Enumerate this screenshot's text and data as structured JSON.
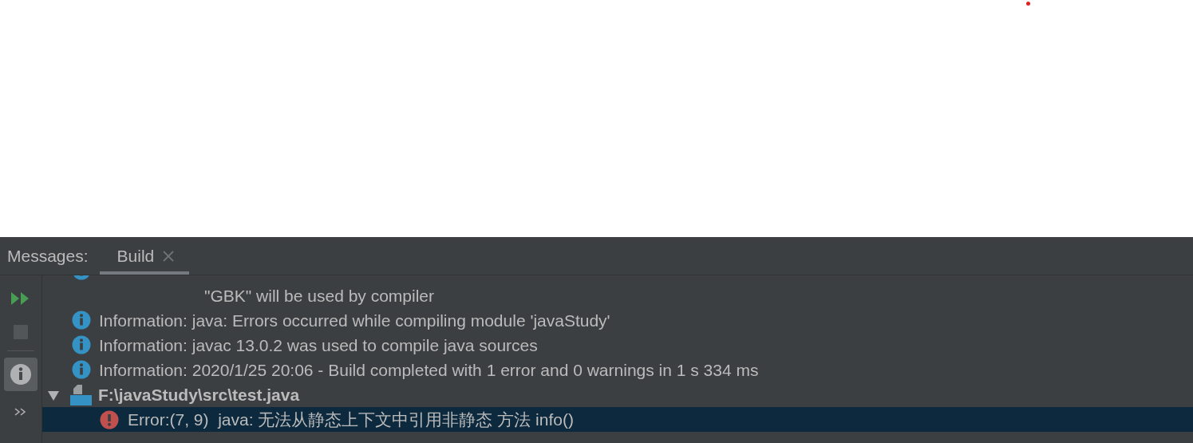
{
  "tool_window": {
    "title": "Messages:",
    "tabs": [
      {
        "label": "Build",
        "selected": true,
        "closable": true
      }
    ]
  },
  "toolbar": [
    {
      "kind": "rerun"
    },
    {
      "kind": "stop",
      "disabled": true
    },
    {
      "kind": "info",
      "selected": true
    },
    {
      "kind": "more"
    }
  ],
  "messages": [
    {
      "kind": "info",
      "continued": true,
      "lines": [
        "\"GBK\" will be used by compiler"
      ]
    },
    {
      "kind": "info",
      "lines": [
        "Information: java: Errors occurred while compiling module 'javaStudy'"
      ]
    },
    {
      "kind": "info",
      "lines": [
        "Information: javac 13.0.2 was used to compile java sources"
      ]
    },
    {
      "kind": "info",
      "lines": [
        "Information: 2020/1/25 20:06 - Build completed with 1 error and 0 warnings in 1 s 334 ms"
      ]
    },
    {
      "kind": "file",
      "text": "F:\\javaStudy\\src\\test.java",
      "expanded": true,
      "children": [
        {
          "kind": "error",
          "text": "Error:(7, 9)  java: 无法从静态上下文中引用非静态 方法 info()",
          "selected": true
        }
      ]
    }
  ]
}
